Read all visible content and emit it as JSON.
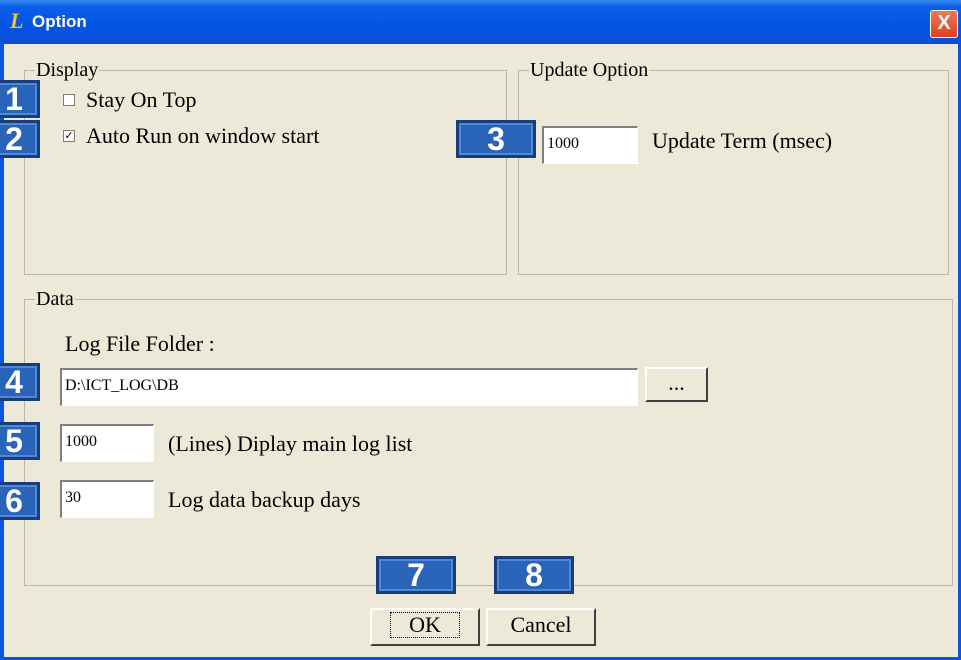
{
  "window": {
    "title": "Option",
    "close_label": "X"
  },
  "display_group": {
    "legend": "Display",
    "stay_on_top": {
      "label": "Stay On Top",
      "checked": false
    },
    "auto_run": {
      "label": "Auto Run on window start",
      "checked": true,
      "check_glyph": "✓"
    }
  },
  "update_group": {
    "legend": "Update Option",
    "update_term_value": "1000",
    "update_term_label": "Update Term (msec)"
  },
  "data_group": {
    "legend": "Data",
    "log_folder_label": "Log File Folder :",
    "log_folder_value": "D:\\ICT_LOG\\DB",
    "browse_label": "...",
    "lines_value": "1000",
    "lines_label": "(Lines) Diplay main log list",
    "backup_value": "30",
    "backup_label": "Log data backup days"
  },
  "buttons": {
    "ok": "OK",
    "cancel": "Cancel"
  },
  "badges": {
    "b1": "1",
    "b2": "2",
    "b3": "3",
    "b4": "4",
    "b5": "5",
    "b6": "6",
    "b7": "7",
    "b8": "8"
  }
}
